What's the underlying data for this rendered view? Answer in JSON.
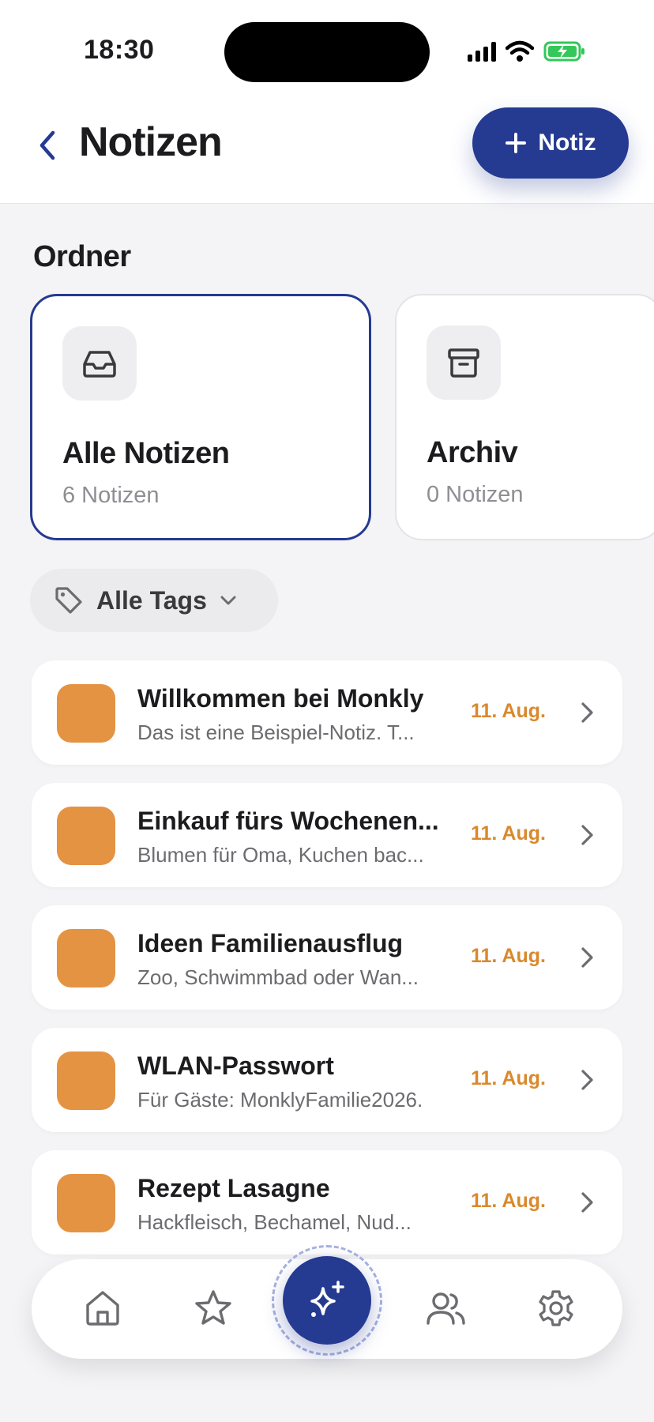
{
  "status_bar": {
    "time": "18:30"
  },
  "header": {
    "title": "Notizen",
    "new_button_label": "Notiz",
    "back_icon": "chevron-left-icon"
  },
  "folders": {
    "section_title": "Ordner",
    "items": [
      {
        "name": "Alle Notizen",
        "count": "6 Notizen",
        "icon": "inbox-icon"
      },
      {
        "name": "Archiv",
        "count": "0 Notizen",
        "icon": "archive-icon"
      }
    ]
  },
  "tag_filter": {
    "label": "Alle Tags"
  },
  "notes": [
    {
      "title": "Willkommen bei Monkly",
      "preview": "Das ist eine Beispiel-Notiz. T...",
      "date": "11. Aug.",
      "color": "#e49343"
    },
    {
      "title": "Einkauf fürs Wochenen...",
      "preview": "Blumen für Oma, Kuchen bac...",
      "date": "11. Aug.",
      "color": "#e49343"
    },
    {
      "title": "Ideen Familienausflug",
      "preview": "Zoo, Schwimmbad oder Wan...",
      "date": "11. Aug.",
      "color": "#e49343"
    },
    {
      "title": "WLAN-Passwort",
      "preview": "Für Gäste: MonklyFamilie2026.",
      "date": "11. Aug.",
      "color": "#e49343"
    },
    {
      "title": "Rezept Lasagne",
      "preview": "Hackfleisch, Bechamel, Nud...",
      "date": "11. Aug.",
      "color": "#e49343"
    }
  ],
  "tabbar": {
    "items": [
      "home-icon",
      "star-icon",
      "sparkles-icon",
      "users-icon",
      "gear-icon"
    ]
  },
  "colors": {
    "primary": "#253a91",
    "accent": "#e49343",
    "date": "#d9892d",
    "background": "#f4f4f6"
  }
}
